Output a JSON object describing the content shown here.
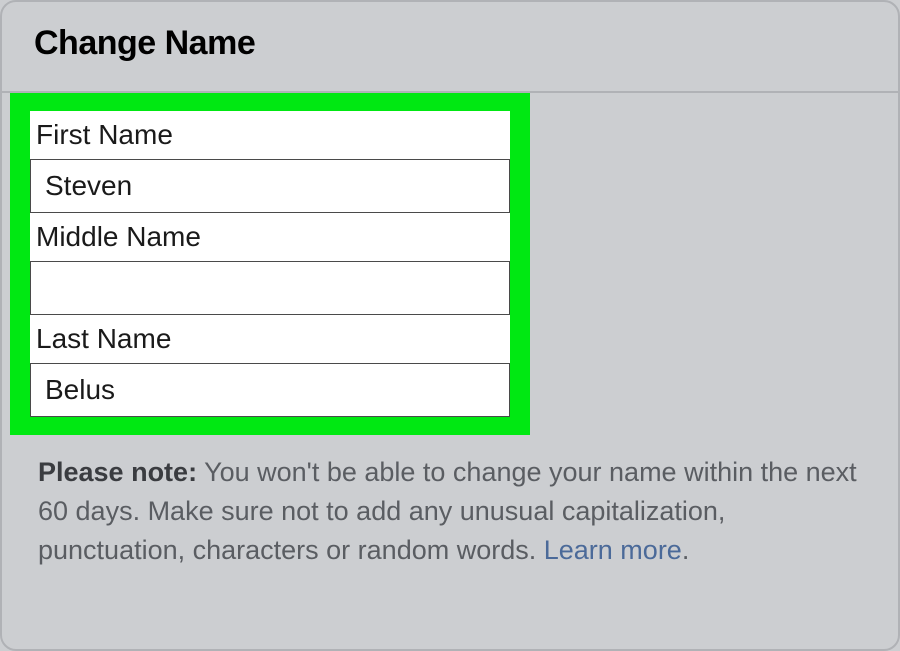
{
  "header": {
    "title": "Change Name"
  },
  "fields": {
    "first": {
      "label": "First Name",
      "value": "Steven"
    },
    "middle": {
      "label": "Middle Name",
      "value": ""
    },
    "last": {
      "label": "Last Name",
      "value": "Belus"
    }
  },
  "note": {
    "label": "Please note:",
    "text": " You won't be able to change your name within the next 60 days. Make sure not to add any unusual capitalization, punctuation, characters or random words. ",
    "link": "Learn more",
    "period": "."
  }
}
